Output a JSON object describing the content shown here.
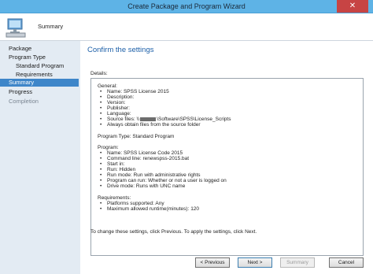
{
  "window": {
    "title": "Create Package and Program Wizard",
    "close_glyph": "✕"
  },
  "header": {
    "title": "Summary"
  },
  "nav": [
    {
      "label": "Package",
      "level": "top",
      "state": "normal"
    },
    {
      "label": "Program Type",
      "level": "top",
      "state": "normal"
    },
    {
      "label": "Standard Program",
      "level": "sub",
      "state": "normal"
    },
    {
      "label": "Requirements",
      "level": "sub",
      "state": "normal"
    },
    {
      "label": "Summary",
      "level": "top",
      "state": "selected"
    },
    {
      "label": "Progress",
      "level": "top",
      "state": "normal"
    },
    {
      "label": "Completion",
      "level": "top",
      "state": "disabled"
    }
  ],
  "main": {
    "title": "Confirm the settings",
    "details_label": "Details:",
    "general": {
      "heading": "General:",
      "items": [
        "Name: SPSS License 2015",
        "Description:",
        "Version:",
        "Publisher:",
        "Language:",
        "Source files: \\\\",
        "Always obtain files from the source folder"
      ],
      "source_suffix": "\\Software\\SPSS\\License_Scripts"
    },
    "program_type": "Program Type: Standard Program",
    "program": {
      "heading": "Program:",
      "items": [
        "Name: SPSS License Code 2015",
        "Command line: renewspss-2015.bat",
        "Start in:",
        "Run: Hidden",
        "Run mode: Run with administrative rights",
        "Program can run: Whether or not a user is logged on",
        "Drive mode: Runs with UNC name"
      ]
    },
    "requirements": {
      "heading": "Requirements:",
      "items": [
        "Platforms supported: Any",
        "Maximum allowed runtime(minutes): 120"
      ]
    },
    "footer_note": "To change these settings, click Previous. To apply the settings, click Next."
  },
  "buttons": {
    "previous": "< Previous",
    "next": "Next >",
    "summary": "Summary",
    "cancel": "Cancel"
  },
  "colors": {
    "titlebar": "#5eb3e6",
    "nav_selected": "#3e86c9",
    "title_accent": "#1c5fa8",
    "close": "#c74444"
  }
}
